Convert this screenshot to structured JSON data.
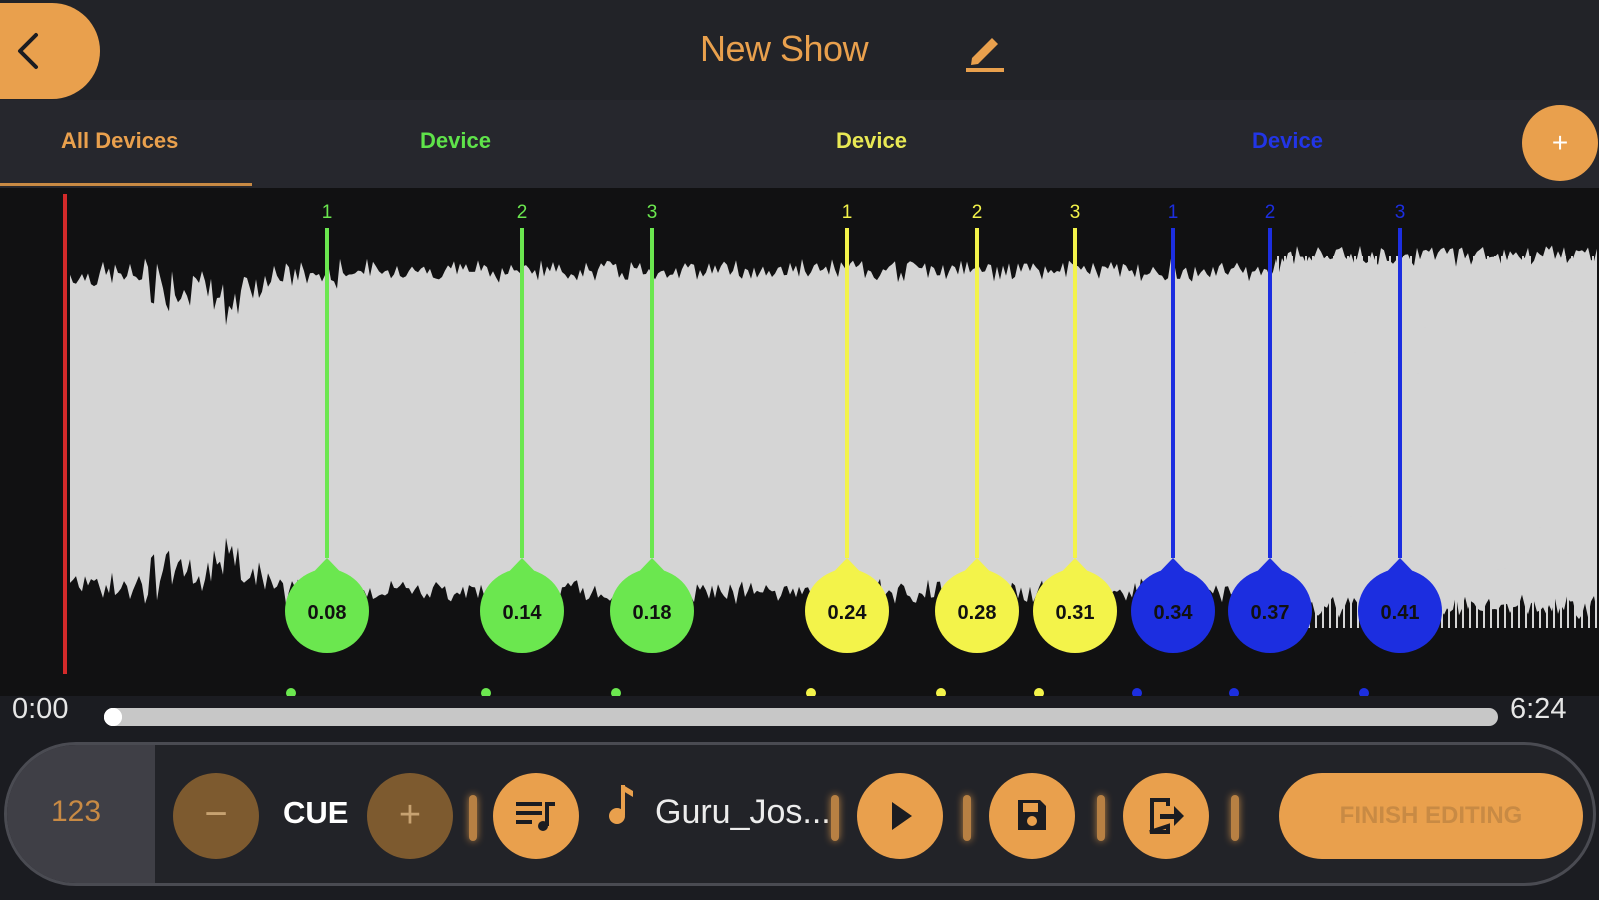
{
  "header": {
    "title": "New Show",
    "back_icon": "chevron-left-icon",
    "edit_icon": "pencil-icon"
  },
  "tabs": [
    {
      "label": "All Devices",
      "color": "#e9a04d",
      "active": true
    },
    {
      "label": "Device",
      "color": "#5fe34a"
    },
    {
      "label": "Device",
      "color": "#e8e854"
    },
    {
      "label": "Device",
      "color": "#2235e6"
    }
  ],
  "add_device_label": "+",
  "cues": [
    {
      "number": "1",
      "time": "0.08",
      "color": "#6be74f"
    },
    {
      "number": "2",
      "time": "0.14",
      "color": "#6be74f"
    },
    {
      "number": "3",
      "time": "0.18",
      "color": "#6be74f"
    },
    {
      "number": "1",
      "time": "0.24",
      "color": "#f3f34a"
    },
    {
      "number": "2",
      "time": "0.28",
      "color": "#f3f34a"
    },
    {
      "number": "3",
      "time": "0.31",
      "color": "#f3f34a"
    },
    {
      "number": "1",
      "time": "0.34",
      "color": "#1c2ee0"
    },
    {
      "number": "2",
      "time": "0.37",
      "color": "#1c2ee0"
    },
    {
      "number": "3",
      "time": "0.41",
      "color": "#1c2ee0"
    }
  ],
  "timeline": {
    "start": "0:00",
    "end": "6:24",
    "progress": 0.0
  },
  "controls": {
    "bpm": "123",
    "minus_label": "−",
    "cue_label": "CUE",
    "plus_label": "+",
    "playlist_icon": "playlist-icon",
    "note_icon": "music-note-icon",
    "song_name": "Guru_Jos...",
    "play_icon": "play-icon",
    "save_icon": "save-icon",
    "export_icon": "export-icon",
    "finish_label": "FINISH EDITING"
  },
  "colors": {
    "accent": "#e9a04d",
    "playhead": "#d42a2a"
  }
}
